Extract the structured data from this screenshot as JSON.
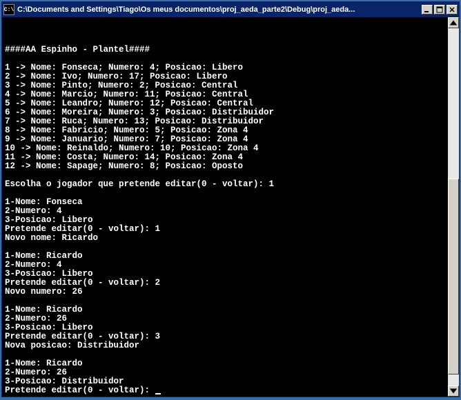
{
  "titlebar": {
    "icon_label": "C:\\",
    "title": "C:\\Documents and Settings\\Tiago\\Os meus documentos\\proj_aeda_parte2\\Debug\\proj_aeda..."
  },
  "console": {
    "header": "####AA Espinho - Plantel####",
    "roster": [
      "1 -> Nome: Fonseca; Numero: 4; Posicao: Libero",
      "2 -> Nome: Ivo; Numero: 17; Posicao: Libero",
      "3 -> Nome: Pinto; Numero: 2; Posicao: Central",
      "4 -> Nome: Marcio; Numero: 11; Posicao: Central",
      "5 -> Nome: Leandro; Numero: 12; Posicao: Central",
      "6 -> Nome: Moreira; Numero: 3; Posicao: Distribuidor",
      "7 -> Nome: Ruca; Numero: 13; Posicao: Distribuidor",
      "8 -> Nome: Fabricio; Numero: 5; Posicao: Zona 4",
      "9 -> Nome: Januario; Numero: 7; Posicao: Zona 4",
      "10 -> Nome: Reinaldo; Numero: 10; Posicao: Zona 4",
      "11 -> Nome: Costa; Numero: 14; Posicao: Zona 4",
      "12 -> Nome: Sapage; Numero: 8; Posicao: Oposto"
    ],
    "prompt_select": "Escolha o jogador que pretende editar(0 - voltar): 1",
    "edit1": {
      "l1": "1-Nome: Fonseca",
      "l2": "2-Numero: 4",
      "l3": "3-Posicao: Libero",
      "l4": "Pretende editar(0 - voltar): 1",
      "l5": "Novo nome: Ricardo"
    },
    "edit2": {
      "l1": "1-Nome: Ricardo",
      "l2": "2-Numero: 4",
      "l3": "3-Posicao: Libero",
      "l4": "Pretende editar(0 - voltar): 2",
      "l5": "Novo numero: 26"
    },
    "edit3": {
      "l1": "1-Nome: Ricardo",
      "l2": "2-Numero: 26",
      "l3": "3-Posicao: Libero",
      "l4": "Pretende editar(0 - voltar): 3",
      "l5": "Nova posicao: Distribuidor"
    },
    "edit4": {
      "l1": "1-Nome: Ricardo",
      "l2": "2-Numero: 26",
      "l3": "3-Posicao: Distribuidor",
      "l4": "Pretende editar(0 - voltar): "
    }
  }
}
